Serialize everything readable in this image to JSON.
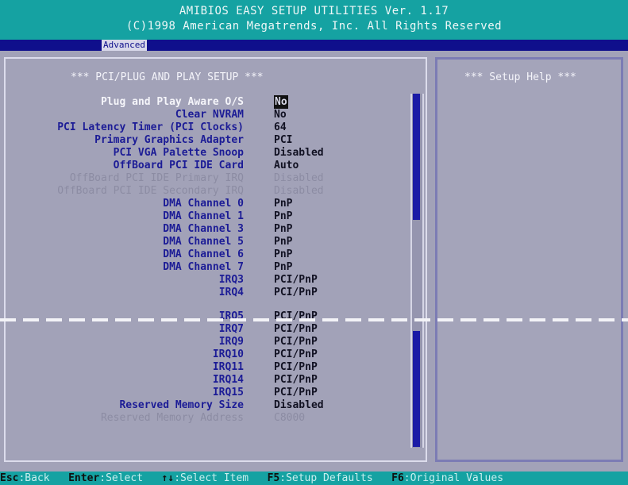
{
  "header": {
    "line1": "AMIBIOS EASY SETUP UTILITIES Ver. 1.17",
    "line2": "(C)1998 American Megatrends, Inc. All Rights Reserved"
  },
  "menu": {
    "tabs": [
      "Advanced"
    ]
  },
  "main": {
    "title": "*** PCI/PLUG AND PLAY SETUP ***",
    "settings": [
      {
        "label": "Plug and Play Aware O/S",
        "value": "No"
      },
      {
        "label": "Clear NVRAM",
        "value": "No"
      },
      {
        "label": "PCI Latency Timer (PCI Clocks)",
        "value": "64"
      },
      {
        "label": "Primary Graphics Adapter",
        "value": "PCI"
      },
      {
        "label": "PCI VGA Palette Snoop",
        "value": "Disabled"
      },
      {
        "label": "OffBoard PCI IDE Card",
        "value": "Auto"
      },
      {
        "label": "OffBoard PCI IDE Primary IRQ",
        "value": "Disabled"
      },
      {
        "label": "OffBoard PCI IDE Secondary IRQ",
        "value": "Disabled"
      },
      {
        "label": "DMA Channel 0",
        "value": "PnP"
      },
      {
        "label": "DMA Channel 1",
        "value": "PnP"
      },
      {
        "label": "DMA Channel 3",
        "value": "PnP"
      },
      {
        "label": "DMA Channel 5",
        "value": "PnP"
      },
      {
        "label": "DMA Channel 6",
        "value": "PnP"
      },
      {
        "label": "DMA Channel 7",
        "value": "PnP"
      },
      {
        "label": "IRQ3",
        "value": "PCI/PnP"
      },
      {
        "label": "IRQ4",
        "value": "PCI/PnP"
      },
      {
        "label": "IRQ5",
        "value": "PCI/PnP"
      },
      {
        "label": "IRQ7",
        "value": "PCI/PnP"
      },
      {
        "label": "IRQ9",
        "value": "PCI/PnP"
      },
      {
        "label": "IRQ10",
        "value": "PCI/PnP"
      },
      {
        "label": "IRQ11",
        "value": "PCI/PnP"
      },
      {
        "label": "IRQ14",
        "value": "PCI/PnP"
      },
      {
        "label": "IRQ15",
        "value": "PCI/PnP"
      },
      {
        "label": "Reserved Memory Size",
        "value": "Disabled"
      },
      {
        "label": "Reserved Memory Address",
        "value": "C8000"
      }
    ]
  },
  "help": {
    "title": "*** Setup Help ***"
  },
  "status": {
    "items": [
      {
        "key": "Esc",
        "desc": ":Back"
      },
      {
        "key": "Enter",
        "desc": ":Select"
      },
      {
        "key": "↑↓",
        "desc": ":Select Item"
      },
      {
        "key": "F5",
        "desc": ":Setup Defaults"
      },
      {
        "key": "F6",
        "desc": ":Original Values"
      }
    ]
  },
  "colors": {
    "header_bg": "#15a2a2",
    "panel_bg": "#a2a2b8",
    "label_blue": "#1c1c96",
    "scroll_thumb": "#1a1aa6"
  }
}
